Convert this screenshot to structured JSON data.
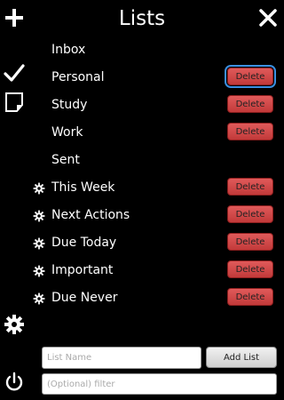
{
  "header": {
    "title": "Lists"
  },
  "sidebar": {
    "icons": [
      "plus-icon",
      "checkmark-icon",
      "note-icon",
      "gear-icon",
      "power-icon"
    ]
  },
  "lists": [
    {
      "name": "Inbox",
      "has_gear": false,
      "delete_label": null
    },
    {
      "name": "Personal",
      "has_gear": false,
      "delete_label": "Delete"
    },
    {
      "name": "Study",
      "has_gear": false,
      "delete_label": "Delete"
    },
    {
      "name": "Work",
      "has_gear": false,
      "delete_label": "Delete"
    },
    {
      "name": "Sent",
      "has_gear": false,
      "delete_label": null
    },
    {
      "name": "This Week",
      "has_gear": true,
      "delete_label": "Delete"
    },
    {
      "name": "Next Actions",
      "has_gear": true,
      "delete_label": "Delete"
    },
    {
      "name": "Due Today",
      "has_gear": true,
      "delete_label": "Delete"
    },
    {
      "name": "Important",
      "has_gear": true,
      "delete_label": "Delete"
    },
    {
      "name": "Due Never",
      "has_gear": true,
      "delete_label": "Delete"
    }
  ],
  "form": {
    "name_placeholder": "List Name",
    "name_value": "",
    "filter_placeholder": "(Optional) filter",
    "filter_value": "",
    "add_label": "Add List"
  },
  "colors": {
    "delete_bg": "#d14848",
    "focus_ring": "#3b8fe0",
    "background": "#000000"
  }
}
